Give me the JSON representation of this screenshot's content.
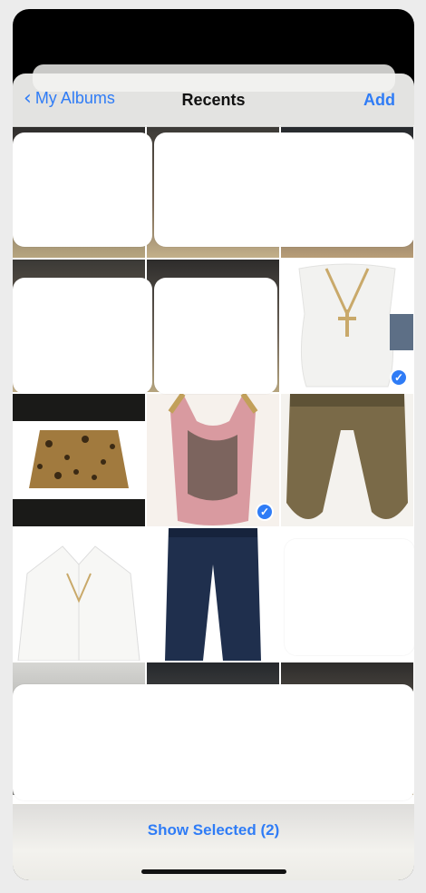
{
  "nav": {
    "back_label": "My Albums",
    "title": "Recents",
    "add_label": "Add"
  },
  "toolbar": {
    "show_selected_label": "Show Selected (2)"
  },
  "selection": {
    "count": 2
  },
  "colors": {
    "accent": "#2f7cf6",
    "check": "#2f7cf6"
  },
  "icons": {
    "back": "chevron-left-icon",
    "selected": "checkmark-circle-icon"
  }
}
